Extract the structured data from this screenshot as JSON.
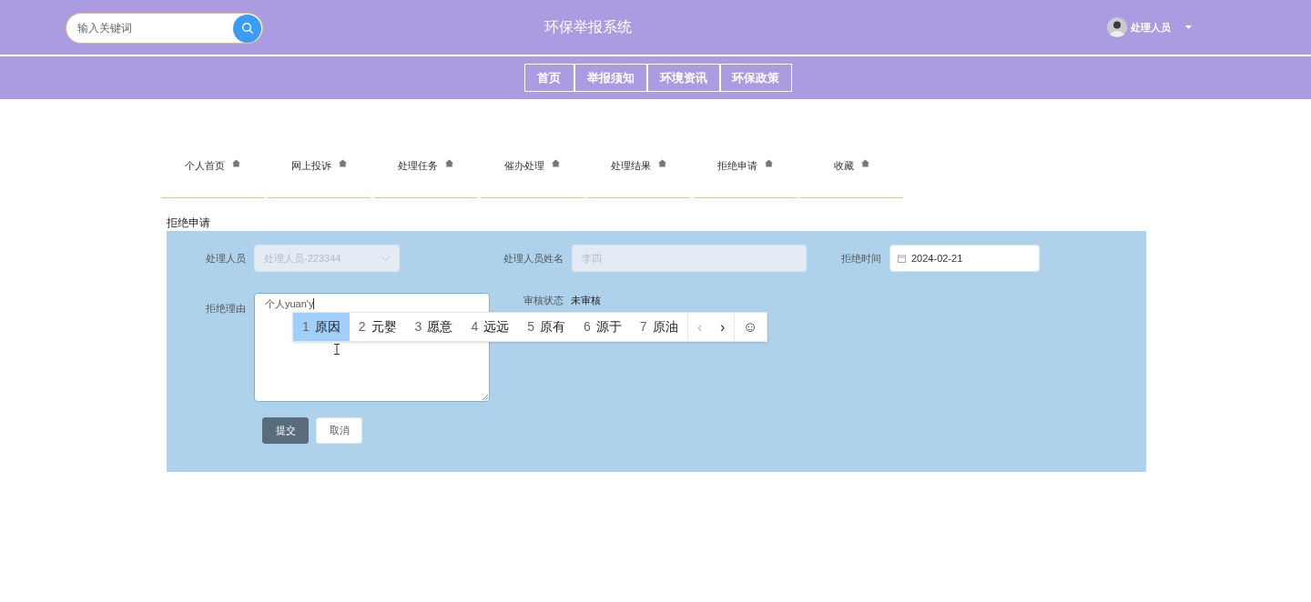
{
  "header": {
    "search": {
      "placeholder": "输入关键词"
    },
    "title": "环保举报系统",
    "user": {
      "name": "处理人员"
    }
  },
  "nav": [
    {
      "label": "首页"
    },
    {
      "label": "举报须知"
    },
    {
      "label": "环境资讯"
    },
    {
      "label": "环保政策"
    }
  ],
  "tabs": [
    {
      "label": "个人首页"
    },
    {
      "label": "网上投诉"
    },
    {
      "label": "处理任务"
    },
    {
      "label": "催办处理"
    },
    {
      "label": "处理结果"
    },
    {
      "label": "拒绝申请"
    },
    {
      "label": "收藏"
    }
  ],
  "section_title": "拒绝申请",
  "form": {
    "handler": {
      "label": "处理人员",
      "value": "处理人员-223344",
      "disabled": true
    },
    "handler_name": {
      "label": "处理人员姓名",
      "value": "李四",
      "disabled": true
    },
    "refuse_time": {
      "label": "拒绝时间",
      "value": "2024-02-21"
    },
    "reason": {
      "label": "拒绝理由",
      "value": "个人yuan'y"
    },
    "review_status": {
      "label": "审核状态",
      "value": "未审核"
    },
    "buttons": [
      {
        "label": "提交",
        "kind": "primary"
      },
      {
        "label": "取消",
        "kind": "default"
      }
    ]
  },
  "ime": {
    "candidates": [
      {
        "index": "1",
        "text": "原因",
        "selected": true
      },
      {
        "index": "2",
        "text": "元婴",
        "selected": false
      },
      {
        "index": "3",
        "text": "愿意",
        "selected": false
      },
      {
        "index": "4",
        "text": "远远",
        "selected": false
      },
      {
        "index": "5",
        "text": "原有",
        "selected": false
      },
      {
        "index": "6",
        "text": "源于",
        "selected": false
      },
      {
        "index": "7",
        "text": "原油",
        "selected": false
      }
    ],
    "prev": "‹",
    "next": "›",
    "emoji": "☺"
  }
}
